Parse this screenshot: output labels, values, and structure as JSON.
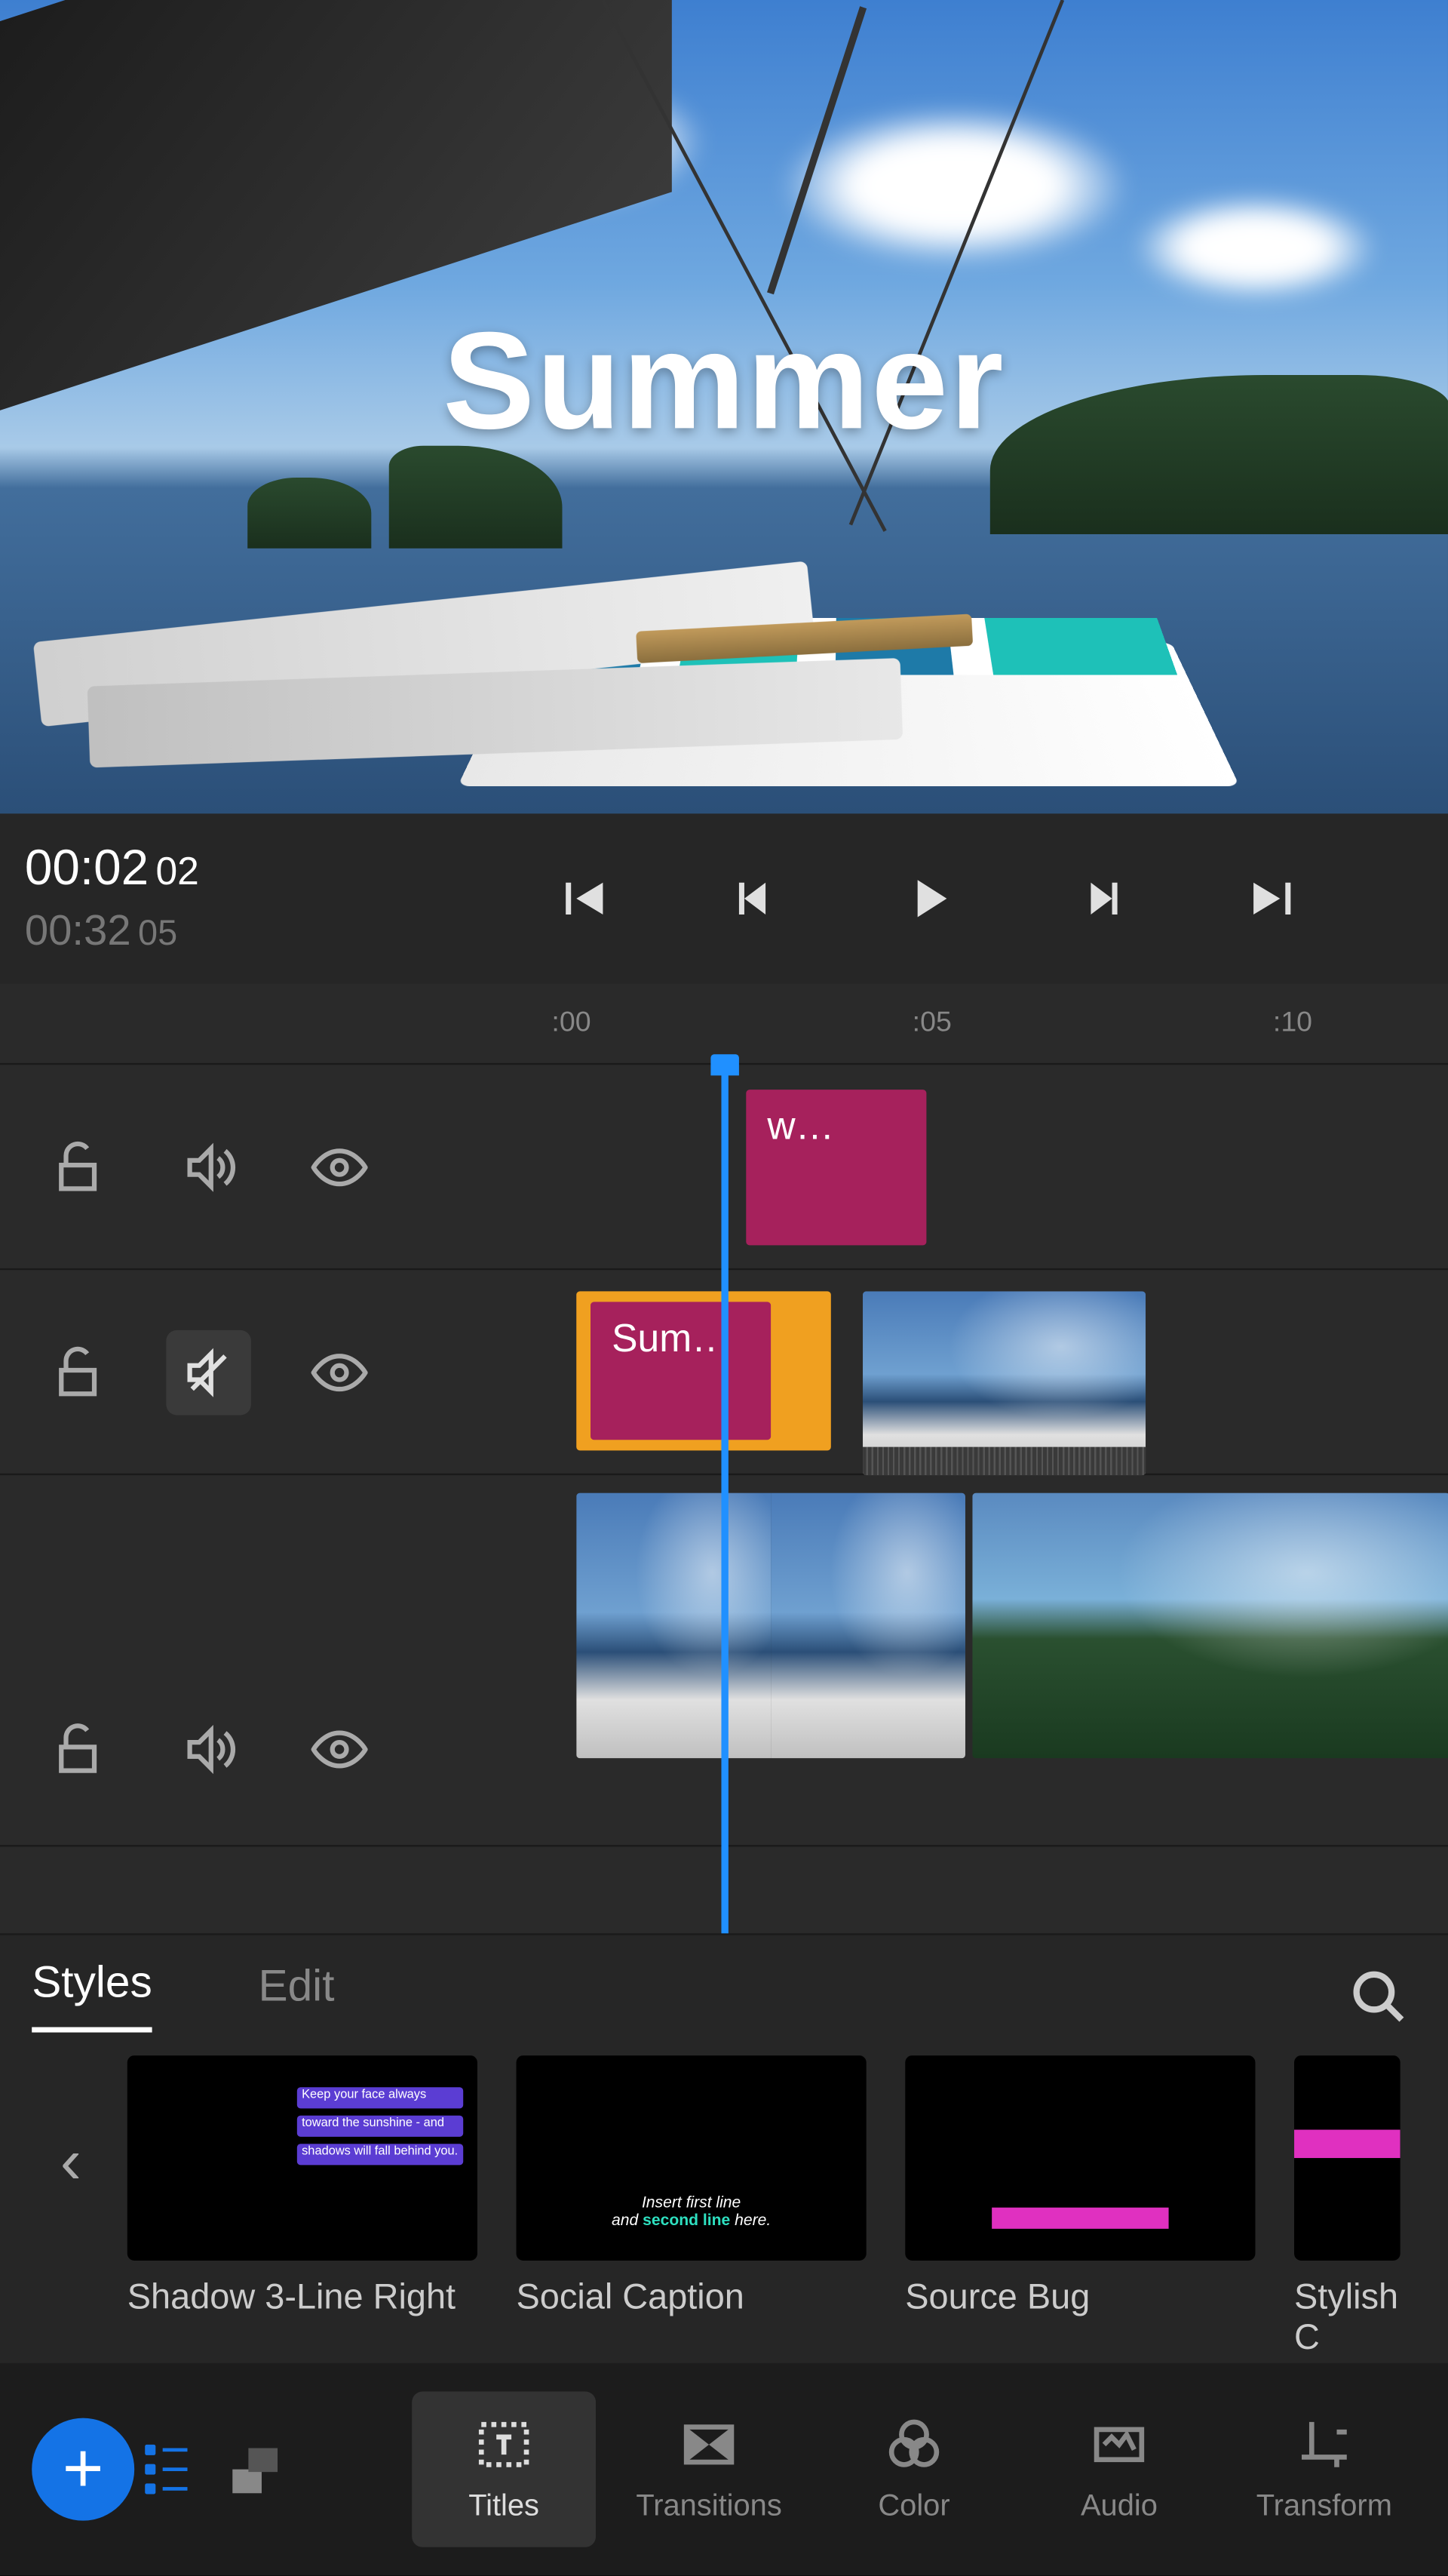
{
  "preview": {
    "title_overlay": "Summer"
  },
  "transport": {
    "current_time": "00:02",
    "current_frames": "02",
    "duration_time": "00:32",
    "duration_frames": "05"
  },
  "timeline": {
    "ruler_ticks": [
      ":00",
      ":05",
      ":10"
    ],
    "tracks": [
      {
        "lock": false,
        "muted": false,
        "visible": true
      },
      {
        "lock": false,
        "muted": true,
        "visible": true
      },
      {
        "lock": false,
        "muted": false,
        "visible": true
      }
    ],
    "clips": {
      "track0_title": "w…",
      "track1_title": "Sum…"
    }
  },
  "panel": {
    "tabs": [
      "Styles",
      "Edit"
    ],
    "active_tab": 0,
    "presets": [
      {
        "label": "Shadow 3-Line Right",
        "lines": [
          "Keep your face always",
          "toward the sunshine - and",
          "shadows will fall behind you."
        ]
      },
      {
        "label": "Social Caption",
        "caption_a": "Insert first line",
        "caption_b": "and ",
        "caption_c": "second line",
        "caption_d": " here."
      },
      {
        "label": "Source Bug"
      },
      {
        "label": "Stylish C"
      }
    ]
  },
  "bottombar": {
    "tools": [
      "Titles",
      "Transitions",
      "Color",
      "Audio",
      "Transform"
    ],
    "active_tool": 0
  }
}
